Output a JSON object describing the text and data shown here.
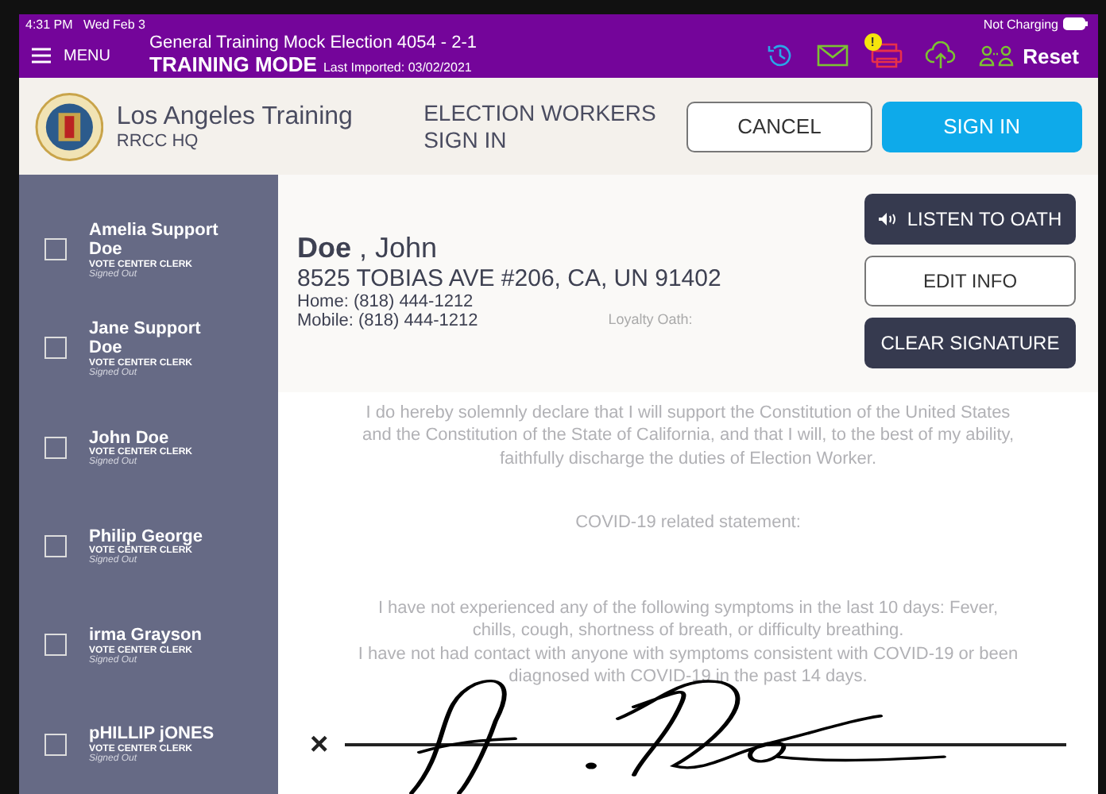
{
  "status_bar": {
    "time": "4:31 PM",
    "date": "Wed Feb 3",
    "charging": "Not Charging"
  },
  "header": {
    "menu": "MENU",
    "title": "General Training Mock Election 4054 - 2-1",
    "mode": "TRAINING MODE",
    "imported": "Last Imported: 03/02/2021",
    "alert_badge": "!",
    "reset": "Reset"
  },
  "top_bar": {
    "org": "Los Angeles Training",
    "site": "RRCC HQ",
    "heading": "ELECTION WORKERS SIGN IN",
    "cancel": "CANCEL",
    "sign_in": "SIGN IN"
  },
  "workers": [
    {
      "name": "Amelia Support Doe",
      "role": "VOTE CENTER CLERK",
      "status": "Signed Out",
      "checked": false
    },
    {
      "name": "Jane Support Doe",
      "role": "VOTE CENTER CLERK",
      "status": "Signed Out",
      "checked": false
    },
    {
      "name": "John  Doe",
      "role": "VOTE CENTER CLERK",
      "status": "Signed Out",
      "checked": false
    },
    {
      "name": "Philip  George",
      "role": "VOTE CENTER CLERK",
      "status": "Signed Out",
      "checked": false
    },
    {
      "name": "irma  Grayson",
      "role": "VOTE CENTER CLERK",
      "status": "Signed Out",
      "checked": false
    },
    {
      "name": "pHILLIP  jONES",
      "role": "VOTE CENTER CLERK",
      "status": "Signed Out",
      "checked": false
    }
  ],
  "detail": {
    "last_name": "Doe",
    "first_name": ", John",
    "address": "8525 TOBIAS AVE #206, CA, UN 91402",
    "home": "Home: (818) 444-1212",
    "mobile": "Mobile: (818) 444-1212",
    "oath_label": "Loyalty Oath:",
    "listen": "LISTEN TO OATH",
    "edit": "EDIT INFO",
    "clear": "CLEAR SIGNATURE"
  },
  "oath": {
    "declaration": "I do hereby solemnly declare that I will support the Constitution of the United States and the Constitution of the State of California, and that I will, to the best of my ability,  faithfully discharge the duties of Election Worker.",
    "covid_heading": "COVID-19 related statement:",
    "covid_lines": [
      "I have not experienced any of the following symptoms in the last 10 days: Fever, chills, cough, shortness of breath, or difficulty breathing.",
      "I have not had contact with anyone with symptoms consistent with COVID-19 or been diagnosed with COVID-19 in the past 14 days."
    ],
    "sign_mark": "×"
  }
}
